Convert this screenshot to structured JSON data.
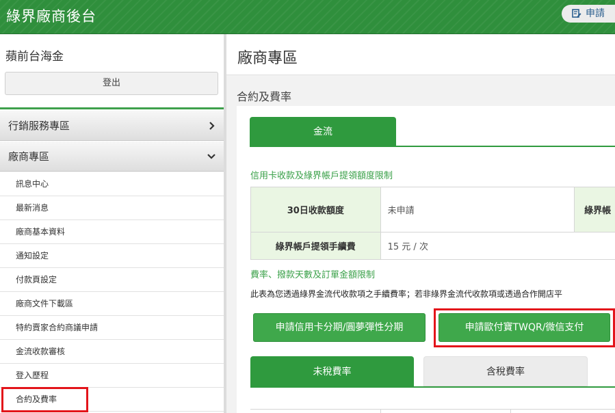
{
  "header": {
    "brand": "綠界廠商後台",
    "apply_label": "申請"
  },
  "sidebar": {
    "merchant_name": "蘋前台海金",
    "logout_label": "登出",
    "sections": [
      {
        "label": "行銷服務專區",
        "chevron": "›"
      },
      {
        "label": "廠商專區",
        "chevron": "⌄"
      }
    ],
    "items": [
      {
        "label": "訊息中心"
      },
      {
        "label": "最新消息"
      },
      {
        "label": "廠商基本資料"
      },
      {
        "label": "通知設定"
      },
      {
        "label": "付款頁設定"
      },
      {
        "label": "廠商文件下載區"
      },
      {
        "label": "特約賣家合約商議申請"
      },
      {
        "label": "金流收款審核"
      },
      {
        "label": "登入歷程"
      },
      {
        "label": "合約及費率"
      }
    ]
  },
  "main": {
    "page_title": "廠商專區",
    "sub_title": "合約及費率",
    "tab_label": "金流",
    "limits_title": "信用卡收款及綠界帳戶提領額度限制",
    "limits_table": {
      "row1_head": "30日收款額度",
      "row1_value": "未申請",
      "row1_head2": "綠界帳",
      "row2_head": "綠界帳戶提領手續費",
      "row2_value": "15 元 / 次"
    },
    "fees_title": "費率、撥款天數及訂單金額限制",
    "fees_note": "此表為您透過綠界金流代收款項之手續費率；若非綠界金流代收款項或透過合作開店平",
    "btn_installment": "申請信用卡分期/圓夢彈性分期",
    "btn_alipay": "申請歐付寶TWQR/微信支付",
    "rate_tabs": [
      "未稅費率",
      "含稅費率"
    ]
  },
  "colors": {
    "brand_green": "#2f8f3c",
    "button_green": "#3fa84b",
    "highlight_red": "#e3141a",
    "label_green": "#39a048"
  }
}
